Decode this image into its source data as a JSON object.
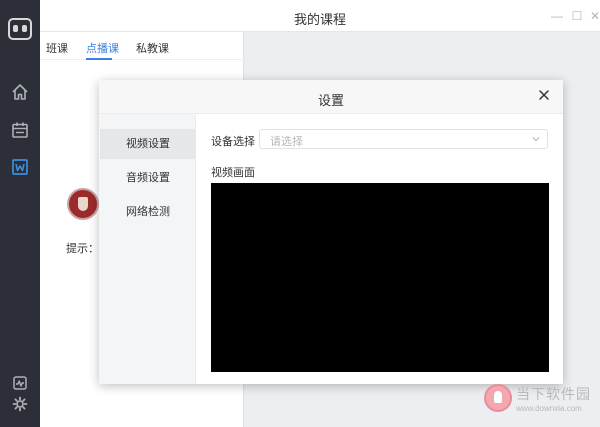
{
  "window": {
    "title": "我的课程",
    "controls": [
      "minimize-icon",
      "maximize-icon",
      "close-icon"
    ]
  },
  "sidebar": {
    "items": [
      {
        "name": "home-icon"
      },
      {
        "name": "calendar-icon"
      },
      {
        "name": "course-icon",
        "active": true
      },
      {
        "name": "pulse-icon"
      },
      {
        "name": "gear-icon"
      }
    ],
    "active_color": "#3b8fe0"
  },
  "tabs": [
    {
      "label": "班课"
    },
    {
      "label": "点播课",
      "active": true
    },
    {
      "label": "私教课"
    }
  ],
  "left_panel": {
    "hint": "提示：亲"
  },
  "dialog": {
    "title": "设置",
    "menu": [
      {
        "label": "视频设置",
        "active": true
      },
      {
        "label": "音频设置"
      },
      {
        "label": "网络检测"
      }
    ],
    "device_label": "设备选择",
    "device_placeholder": "请选择",
    "preview_label": "视频画面"
  },
  "watermark": {
    "text": "当下软件园",
    "url": "www.downxia.com"
  },
  "colors": {
    "accent": "#3b7ee0",
    "sidebar_bg": "#2c2f38",
    "preview_bg": "#000000"
  }
}
